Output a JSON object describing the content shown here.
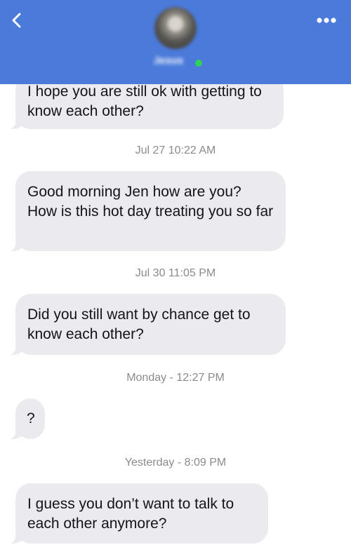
{
  "header": {
    "contact_name": "Jesus",
    "online_status_color": "#2fd35a",
    "accent_color": "#4a7ada",
    "back_icon": "chevron-left-icon",
    "more_icon": "more-horizontal-icon"
  },
  "messages": [
    {
      "text": "I hope you are still ok with getting to know each other?"
    },
    {
      "text": "Good morning Jen how are you? How is this hot day treating you so far"
    },
    {
      "text": "Did you still want by chance get to know each other?"
    },
    {
      "text": "?"
    },
    {
      "text": "I guess you don’t want to talk to each other anymore?"
    }
  ],
  "timestamps": [
    "Jul 27 10:22 AM",
    "Jul 30 11:05 PM",
    "Monday - 12:27 PM",
    "Yesterday - 8:09 PM"
  ]
}
